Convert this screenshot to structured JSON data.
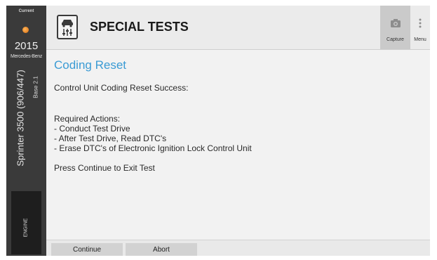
{
  "sidebar": {
    "status_label": "Current",
    "year": "2015",
    "make": "Mercedes-Benz",
    "model": "Sprinter 3500 (906/447)",
    "sub_model": "Base 2.1",
    "system_tab": "ENGINE",
    "status_dot_color": "#e8861e"
  },
  "header": {
    "title": "SPECIAL TESTS",
    "icon": "vehicle-settings-icon",
    "capture_label": "Capture",
    "menu_label": "Menu"
  },
  "content": {
    "title": "Coding Reset",
    "status": "Control Unit Coding Reset Success:",
    "actions_header": "Required Actions:",
    "actions": [
      " - Conduct Test Drive",
      " - After Test Drive, Read DTC's",
      " - Erase DTC's of Electronic Ignition Lock Control Unit"
    ],
    "instruction": "Press Continue to Exit Test",
    "title_color": "#3a9bd4"
  },
  "footer": {
    "continue_label": "Continue",
    "abort_label": "Abort"
  }
}
